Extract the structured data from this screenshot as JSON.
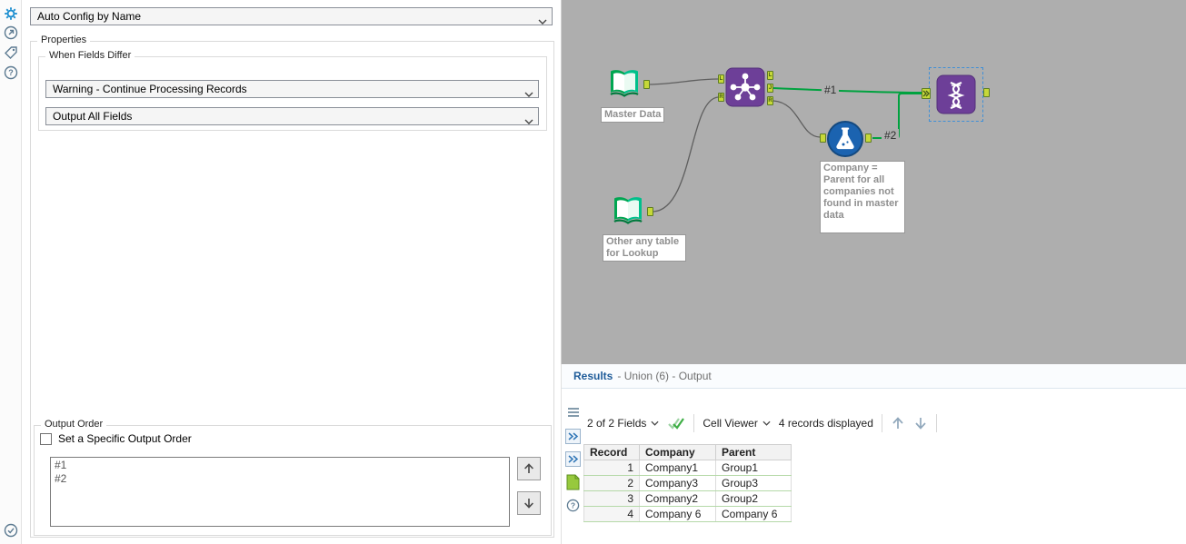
{
  "icons": {
    "left_toolbar": [
      "gear-icon",
      "open-circle-icon",
      "tag-icon",
      "help-circle-icon",
      "check-circle-icon"
    ],
    "results_strip": [
      "menu-icon",
      "expand-chevrons-icon",
      "expand-chevrons-icon",
      "output-anchor-icon",
      "help-circle-icon"
    ],
    "toolbar_icons": [
      "dropdown-caret-icon",
      "double-check-icon",
      "up-arrow-icon",
      "down-arrow-icon"
    ]
  },
  "colors": {
    "accent_green": "#00a23f",
    "anchor_green": "#c6d839",
    "tool_purple": "#6d3f98",
    "input_tool_green": "#00a651",
    "formula_blue": "#1b63b0",
    "canvas_gray": "#aeaeae",
    "results_title_blue": "#1f5c99",
    "row_divider_green": "#b5d9a8"
  },
  "config": {
    "mode_dropdown_value": "Auto Config by Name",
    "properties_label": "Properties",
    "when_fields_differ": {
      "label": "When Fields Differ",
      "behavior_value": "Warning - Continue Processing Records",
      "fields_value": "Output All Fields"
    },
    "output_order": {
      "label": "Output Order",
      "checkbox_label": "Set a Specific Output Order",
      "checkbox_checked": false,
      "items": [
        "#1",
        "#2"
      ]
    }
  },
  "canvas": {
    "tools": {
      "input_master": {
        "label": "Master Data"
      },
      "input_lookup": {
        "label": "Other any table for Lookup"
      },
      "join": {
        "input_anchors": [
          "L",
          "R"
        ],
        "output_anchors": [
          "L",
          "J",
          "R"
        ]
      },
      "formula": {
        "annotation": "Company = Parent for all companies not found in master data"
      },
      "union": {
        "selected": true
      }
    },
    "connections": {
      "first_label": "#1",
      "second_label": "#2"
    }
  },
  "results": {
    "title": "Results",
    "subtitle": "- Union (6) - Output",
    "toolbar": {
      "fields_selector": "2 of 2 Fields",
      "cell_viewer": "Cell Viewer",
      "records_displayed": "4 records displayed"
    },
    "table": {
      "columns": [
        "Record",
        "Company",
        "Parent"
      ],
      "rows": [
        [
          "1",
          "Company1",
          "Group1"
        ],
        [
          "2",
          "Company3",
          "Group3"
        ],
        [
          "3",
          "Company2",
          "Group2"
        ],
        [
          "4",
          "Company 6",
          "Company 6"
        ]
      ]
    }
  }
}
